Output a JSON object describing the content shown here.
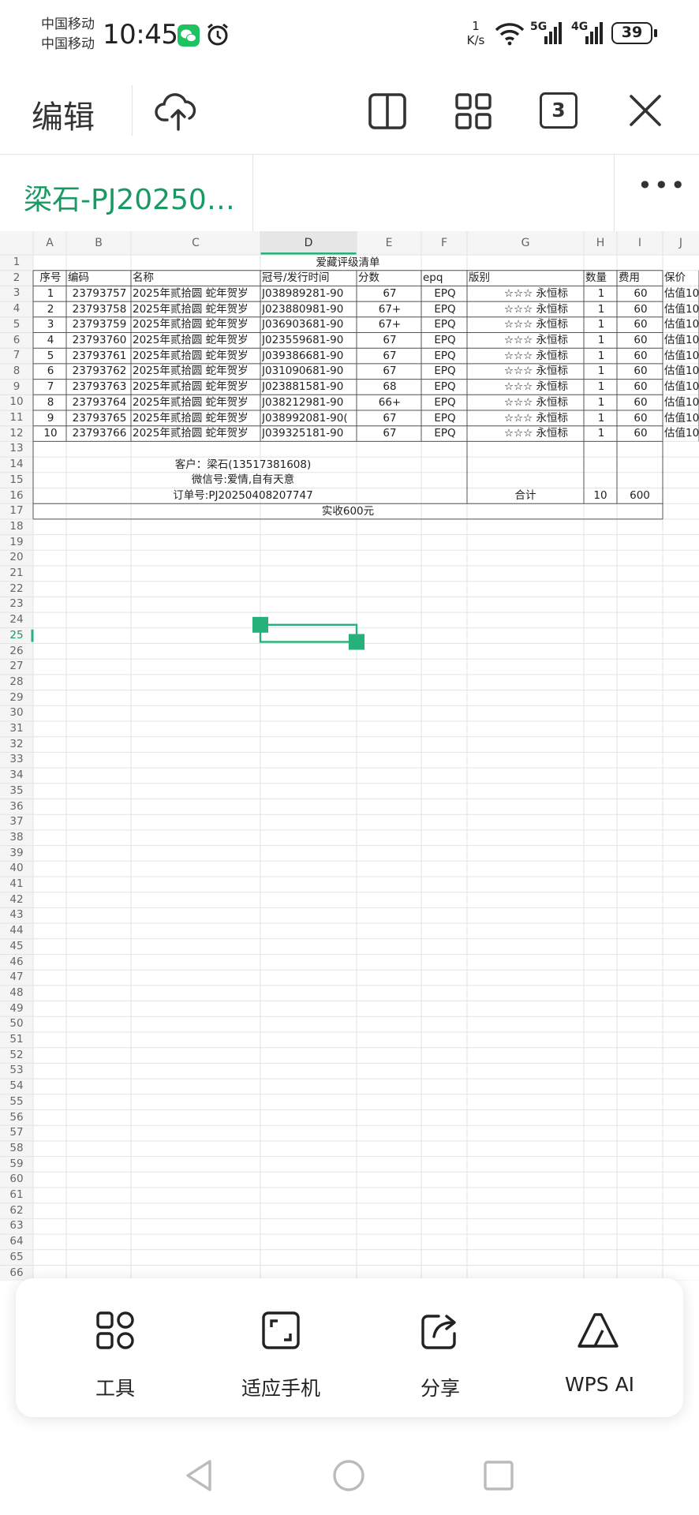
{
  "status_bar": {
    "carrier_1": "中国移动",
    "carrier_2": "中国移动",
    "time": "10:45",
    "net_speed_value": "1",
    "net_speed_unit": "K/s",
    "signal_1": "5G",
    "signal_2": "4G",
    "battery": "39"
  },
  "toolbar": {
    "edit_label": "编辑",
    "page_count": "3"
  },
  "file": {
    "title": "梁石-PJ20250…",
    "more": "•••"
  },
  "sheet": {
    "col_headers": [
      "A",
      "B",
      "C",
      "D",
      "E",
      "F",
      "G",
      "H",
      "I",
      "J"
    ],
    "title": "爱藏评级清单",
    "header_row": [
      "序号",
      "编码",
      "名称",
      "冠号/发行时间",
      "分数",
      "epq",
      "版别",
      "数量",
      "费用",
      "保价"
    ],
    "rows": [
      [
        "1",
        "23793757",
        "2025年贰拾圆 蛇年贺岁",
        "J038989281-90",
        "67",
        "EPQ",
        "☆☆☆ 永恒标",
        "1",
        "60",
        "估值10"
      ],
      [
        "2",
        "23793758",
        "2025年贰拾圆 蛇年贺岁",
        "J023880981-90",
        "67+",
        "EPQ",
        "☆☆☆ 永恒标",
        "1",
        "60",
        "估值10"
      ],
      [
        "3",
        "23793759",
        "2025年贰拾圆 蛇年贺岁",
        "J036903681-90",
        "67+",
        "EPQ",
        "☆☆☆ 永恒标",
        "1",
        "60",
        "估值10"
      ],
      [
        "4",
        "23793760",
        "2025年贰拾圆 蛇年贺岁",
        "J023559681-90",
        "67",
        "EPQ",
        "☆☆☆ 永恒标",
        "1",
        "60",
        "估值10"
      ],
      [
        "5",
        "23793761",
        "2025年贰拾圆 蛇年贺岁",
        "J039386681-90",
        "67",
        "EPQ",
        "☆☆☆ 永恒标",
        "1",
        "60",
        "估值10"
      ],
      [
        "6",
        "23793762",
        "2025年贰拾圆 蛇年贺岁",
        "J031090681-90",
        "67",
        "EPQ",
        "☆☆☆ 永恒标",
        "1",
        "60",
        "估值10"
      ],
      [
        "7",
        "23793763",
        "2025年贰拾圆 蛇年贺岁",
        "J023881581-90",
        "68",
        "EPQ",
        "☆☆☆ 永恒标",
        "1",
        "60",
        "估值10"
      ],
      [
        "8",
        "23793764",
        "2025年贰拾圆 蛇年贺岁",
        "J038212981-90",
        "66+",
        "EPQ",
        "☆☆☆ 永恒标",
        "1",
        "60",
        "估值10"
      ],
      [
        "9",
        "23793765",
        "2025年贰拾圆 蛇年贺岁",
        "J038992081-90(",
        "67",
        "EPQ",
        "☆☆☆ 永恒标",
        "1",
        "60",
        "估值10"
      ],
      [
        "10",
        "23793766",
        "2025年贰拾圆 蛇年贺岁",
        "J039325181-90",
        "67",
        "EPQ",
        "☆☆☆ 永恒标",
        "1",
        "60",
        "估值10"
      ]
    ],
    "customer": "客户：梁石(13517381608)",
    "wechat": "微信号:爱情,自有天意",
    "order_no": "订单号:PJ20250408207747",
    "total_label": "合计",
    "total_qty": "10",
    "total_fee": "600",
    "received": "实收600元",
    "row_count": 66
  },
  "bottom_panel": {
    "tools": "工具",
    "fit_phone": "适应手机",
    "share": "分享",
    "wps_ai": "WPS AI"
  },
  "colors": {
    "accent": "#1a9a63",
    "selection": "#26b07a"
  }
}
